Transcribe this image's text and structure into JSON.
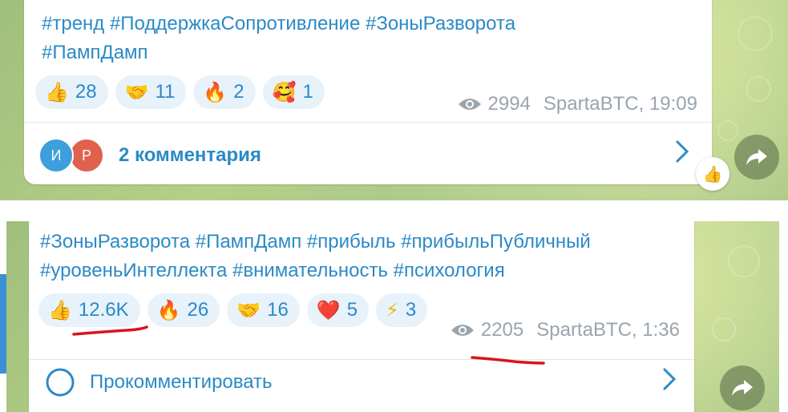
{
  "post1": {
    "hashtags_line1": "#тренд #ПоддержкаСопротивление #ЗоныРазворота",
    "hashtags_line2": "#ПампДамп",
    "reactions": [
      {
        "emoji": "👍",
        "count": "28",
        "icon": "thumbs-up-icon"
      },
      {
        "emoji": "🤝",
        "count": "11",
        "icon": "handshake-icon"
      },
      {
        "emoji": "🔥",
        "count": "2",
        "icon": "fire-icon"
      },
      {
        "emoji": "🥰",
        "count": "1",
        "icon": "smiling-face-hearts-icon"
      }
    ],
    "views": "2994",
    "author_time": "SpartaBTC, 19:09",
    "avatars": [
      {
        "letter": "И",
        "color": "#3d9fdc"
      },
      {
        "letter": "Р",
        "color": "#e0614d"
      }
    ],
    "comments_label": "2 комментария",
    "own_reaction_emoji": "👍"
  },
  "post2": {
    "hashtags_line1": "#ЗоныРазворота #ПампДамп #прибыль #прибыльПубличный",
    "hashtags_line2": "#уровеньИнтеллекта #внимательность #психология",
    "reactions": [
      {
        "emoji": "👍",
        "count": "12.6K",
        "icon": "thumbs-up-icon"
      },
      {
        "emoji": "🔥",
        "count": "26",
        "icon": "fire-icon"
      },
      {
        "emoji": "🤝",
        "count": "16",
        "icon": "handshake-icon"
      },
      {
        "emoji": "❤️",
        "count": "5",
        "icon": "heart-icon"
      },
      {
        "emoji": "⚡",
        "count": "3",
        "icon": "lightning-icon"
      }
    ],
    "views": "2205",
    "author_time": "SpartaBTC, 1:36",
    "comment_label": "Прокомментировать"
  },
  "colors": {
    "link_blue": "#2b8ac6",
    "reaction_bg": "#e7f2fb",
    "meta_gray": "#9aa4ad",
    "annotation_red": "#d8141d"
  }
}
